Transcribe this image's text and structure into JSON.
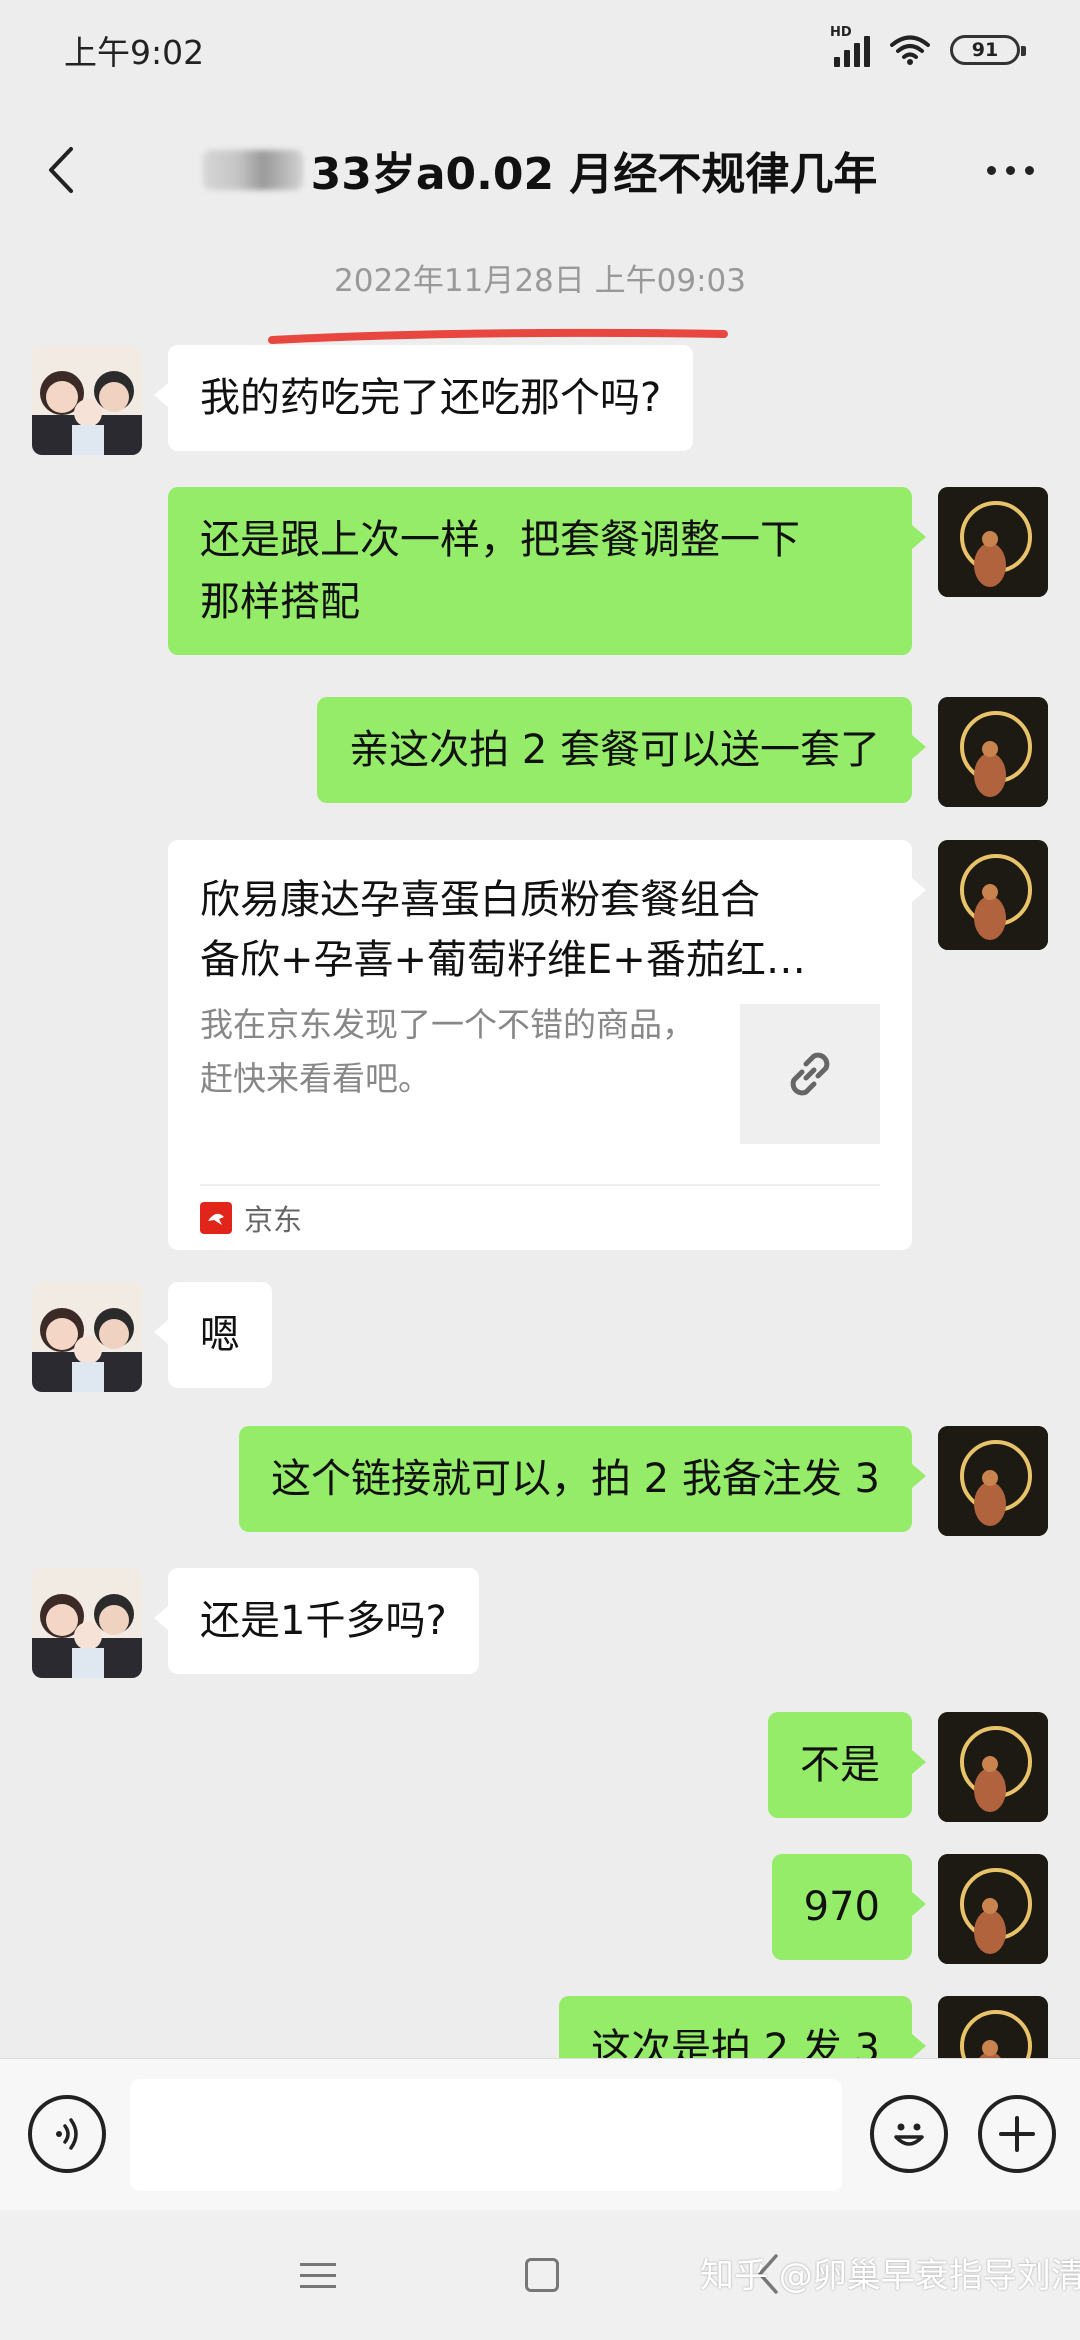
{
  "status_bar": {
    "time": "上午9:02",
    "network_label": "HD",
    "battery": "91"
  },
  "header": {
    "title": "33岁a0.02 月经不规律几年"
  },
  "chat": {
    "timestamp": "2022年11月28日 上午09:03",
    "messages": [
      {
        "side": "left",
        "text": "我的药吃完了还吃那个吗?"
      },
      {
        "side": "right",
        "text_line1": "还是跟上次一样，把套餐调整一下",
        "text_line2": "那样搭配"
      },
      {
        "side": "right",
        "text": "亲这次拍 2 套餐可以送一套了"
      },
      {
        "side": "right",
        "type": "link",
        "title_line1": "欣易康达孕喜蛋白质粉套餐组合",
        "title_line2": "备欣+孕喜+葡萄籽维E+番茄红…",
        "desc": "我在京东发现了一个不错的商品，赶快来看看吧。",
        "source": "京东",
        "thumb_icon": "link-icon"
      },
      {
        "side": "left",
        "text": "嗯"
      },
      {
        "side": "right",
        "text": "这个链接就可以，拍 2 我备注发 3"
      },
      {
        "side": "left",
        "text": "还是1千多吗?"
      },
      {
        "side": "right",
        "text": "不是"
      },
      {
        "side": "right",
        "text": "970"
      },
      {
        "side": "right",
        "text": "这次是拍 2 发 3"
      }
    ]
  },
  "input_bar": {
    "voice_icon": "voice-icon",
    "emoji_icon": "emoji-icon",
    "plus_icon": "plus-icon",
    "input_value": ""
  },
  "watermark": "知乎 @卵巢早衰指导刘清",
  "colors": {
    "background": "#ededed",
    "bubble_self": "#95ec69",
    "bubble_other": "#ffffff",
    "timestamp": "#999999",
    "underline": "#e8473f",
    "jd_red": "#e1251b"
  }
}
